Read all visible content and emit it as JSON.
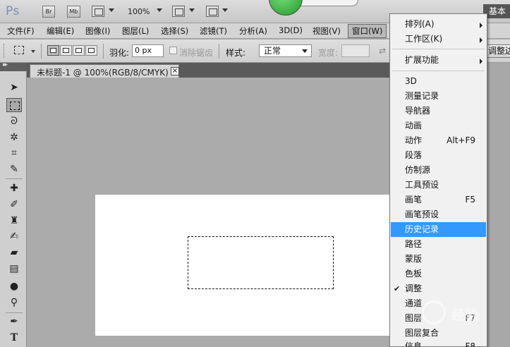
{
  "app": {
    "logo": "Ps",
    "bridge_label": "Br",
    "minibridge_label": "Mb",
    "zoom": "100%",
    "workspace": "基本"
  },
  "menubar": {
    "items": [
      "文件(F)",
      "编辑(E)",
      "图像(I)",
      "图层(L)",
      "选择(S)",
      "滤镜(T)",
      "分析(A)",
      "3D(D)",
      "视图(V)",
      "窗口(W)"
    ],
    "active": "窗口(W)"
  },
  "options": {
    "feather_label": "羽化:",
    "feather_value": "0 px",
    "antialias_label": "消除锯齿",
    "style_label": "样式:",
    "style_value": "正常",
    "width_label": "宽度:",
    "refine_label": "调整边缘..."
  },
  "document": {
    "tab_title": "未标题-1 @ 100%(RGB/8/CMYK) *",
    "close_glyph": "×"
  },
  "window_menu": {
    "items": [
      {
        "label": "排列(A)",
        "submenu": true
      },
      {
        "label": "工作区(K)",
        "submenu": true
      },
      {
        "label": "扩展功能",
        "submenu": true
      },
      {
        "label": "3D"
      },
      {
        "label": "测量记录"
      },
      {
        "label": "导航器"
      },
      {
        "label": "动画"
      },
      {
        "label": "动作",
        "shortcut": "Alt+F9"
      },
      {
        "label": "段落"
      },
      {
        "label": "仿制源"
      },
      {
        "label": "工具预设"
      },
      {
        "label": "画笔",
        "shortcut": "F5"
      },
      {
        "label": "画笔预设"
      },
      {
        "label": "历史记录",
        "highlighted": true
      },
      {
        "label": "路径"
      },
      {
        "label": "蒙版"
      },
      {
        "label": "色板"
      },
      {
        "label": "调整",
        "checked": true
      },
      {
        "label": "通道"
      },
      {
        "label": "图层",
        "shortcut": "F7"
      },
      {
        "label": "图层复合"
      },
      {
        "label": "信息",
        "shortcut": "F8"
      }
    ]
  },
  "watermark": {
    "text": "经验"
  },
  "colors": {
    "highlight": "#3399ff",
    "menu_bg": "#f1f1f1",
    "canvas_bg": "#ababab"
  }
}
